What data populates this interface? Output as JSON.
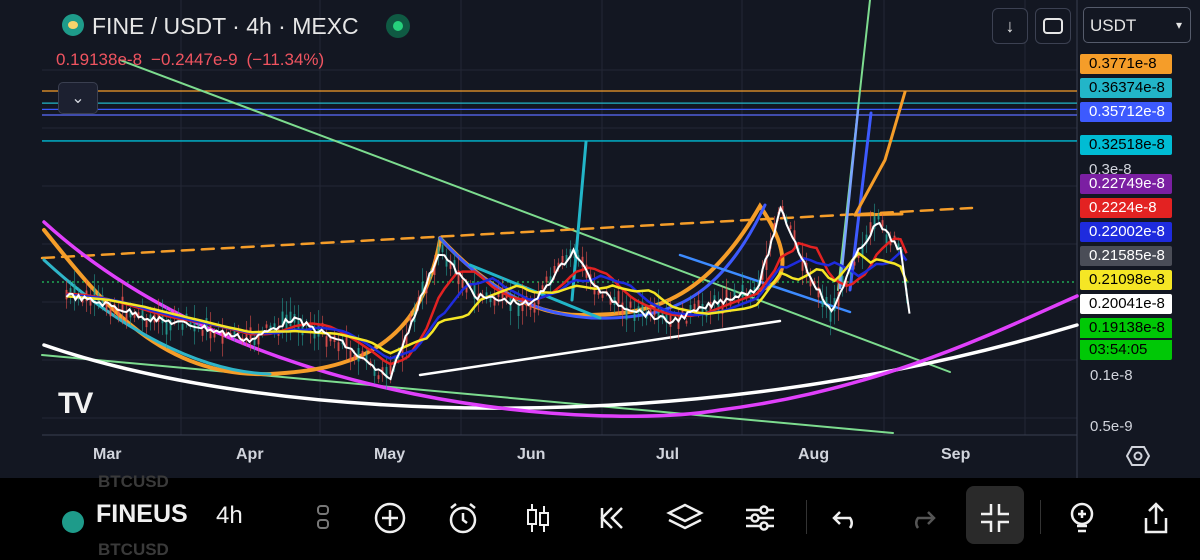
{
  "header": {
    "title": "FINE / USDT · 4h · MEXC",
    "ohlc": [
      "0.19138e-8",
      "−0.2447e-9",
      "(−11.34%)"
    ]
  },
  "toolbar": {
    "download_icon": "download-arrow-icon",
    "fullscreen_icon": "rounded-square-icon",
    "currency": "USDT"
  },
  "price_axis": {
    "labels": [
      {
        "text": "0.3771e-8",
        "bg": "#f59d29",
        "fg": "#000000"
      },
      {
        "text": "0.36374e-8",
        "bg": "#22b5c8",
        "fg": "#000000"
      },
      {
        "text": "0.35712e-8",
        "bg": "#3d5afe",
        "fg": "#ffffff"
      },
      {
        "text": "0.32518e-8",
        "bg": "#00bcd4",
        "fg": "#000000"
      },
      {
        "text": "0.3e-8",
        "bg": "",
        "fg": "#d1d4dc"
      },
      {
        "text": "0.22749e-8",
        "bg": "#7b1fa2",
        "fg": "#ffffff"
      },
      {
        "text": "0.2224e-8",
        "bg": "#e32222",
        "fg": "#ffffff"
      },
      {
        "text": "0.22002e-8",
        "bg": "#1e2bde",
        "fg": "#ffffff"
      },
      {
        "text": "0.21585e-8",
        "bg": "#4a4d57",
        "fg": "#ffffff"
      },
      {
        "text": "0.21098e-8",
        "bg": "#f5e625",
        "fg": "#000000"
      },
      {
        "text": "0.20041e-8",
        "bg": "#ffffff",
        "fg": "#000000"
      },
      {
        "text": "0.19138e-8",
        "bg": "#00c806",
        "fg": "#000000"
      },
      {
        "text": "03:54:05",
        "bg": "#00c806",
        "fg": "#000000"
      }
    ],
    "ticks": [
      "0.1e-8",
      "0.5e-9"
    ],
    "settings_icon": "settings-hexagon-icon"
  },
  "time_axis": {
    "months": [
      "Mar",
      "Apr",
      "May",
      "Jun",
      "Jul",
      "Aug",
      "Sep"
    ]
  },
  "watermark": "TV",
  "bottom_bar": {
    "symbol": "FINEUS",
    "ghost_top": "BTCUSD",
    "ghost_bottom": "BTCUSD",
    "interval": "4h",
    "icons": [
      "more-vertical-icon",
      "add-circle-icon",
      "alarm-icon",
      "candles-icon",
      "replay-icon",
      "layers-icon",
      "sliders-icon",
      "undo-icon",
      "redo-icon",
      "collapse-icon",
      "idea-bulb-icon",
      "share-icon"
    ]
  },
  "chart_data": {
    "type": "line",
    "title": "FINE / USDT · 4h · MEXC",
    "xlabel": "",
    "ylabel": "",
    "log_scale": true,
    "grid": true,
    "x": [
      "Mar",
      "Apr",
      "May",
      "Jun",
      "Jul",
      "Aug",
      "Sep"
    ],
    "series": [
      {
        "name": "",
        "role": "price",
        "color": "#ffffff",
        "x": [
          "02-20",
          "03-01",
          "03-10",
          "03-20",
          "04-01",
          "04-10",
          "04-20",
          "05-01",
          "05-08",
          "05-12",
          "05-20",
          "06-01",
          "06-10",
          "06-15",
          "06-20",
          "07-01",
          "07-10",
          "07-20",
          "07-25",
          "07-31",
          "08-05",
          "08-10",
          "08-15",
          "08-20",
          "08-22"
        ],
        "values": [
          0.206,
          0.2,
          0.192,
          0.188,
          0.18,
          0.192,
          0.18,
          0.16,
          0.205,
          0.235,
          0.205,
          0.2,
          0.235,
          0.21,
          0.2,
          0.19,
          0.2,
          0.21,
          0.265,
          0.22,
          0.195,
          0.23,
          0.255,
          0.235,
          0.19138
        ]
      }
    ],
    "horizontal_levels": [
      0.3771,
      0.36374,
      0.35712,
      0.32518,
      0.20041
    ],
    "unit_note": "values in e-8"
  }
}
